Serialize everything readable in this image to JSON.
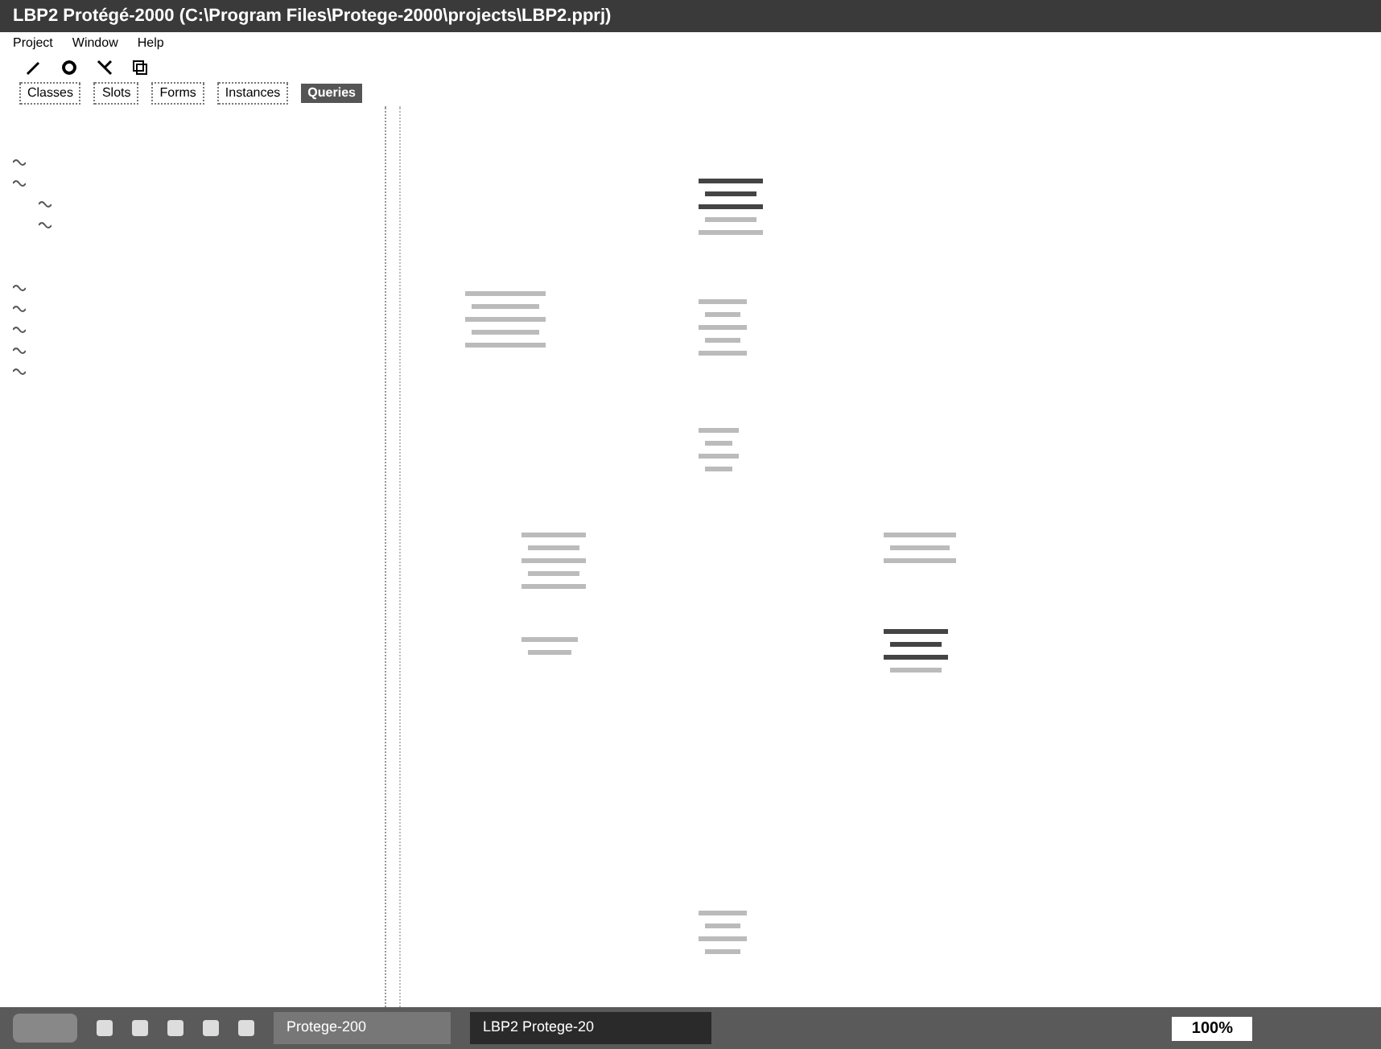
{
  "window": {
    "title": "LBP2 Protégé-2000 (C:\\Program Files\\Protege-2000\\projects\\LBP2.pprj)"
  },
  "menu": [
    "Project",
    "Window",
    "Help"
  ],
  "tabs": [
    {
      "label": "Classes",
      "selected": false
    },
    {
      "label": "Slots",
      "selected": false
    },
    {
      "label": "Forms",
      "selected": false
    },
    {
      "label": "Instances",
      "selected": false
    },
    {
      "label": "Queries",
      "selected": true
    }
  ],
  "taskbar": {
    "tasks": [
      {
        "label": "Protege-200",
        "selected": false
      },
      {
        "label": "LBP2 Protege-20",
        "selected": true
      }
    ],
    "zoom": "100%"
  }
}
